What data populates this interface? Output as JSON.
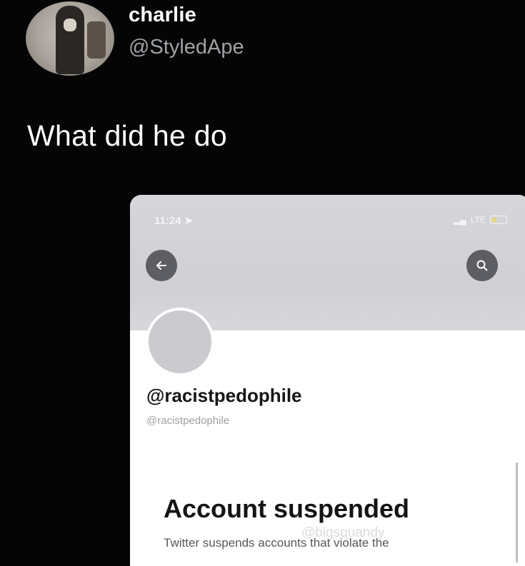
{
  "tweet": {
    "display_name": "charlie",
    "handle": "@StyledApe",
    "text": "What did he do"
  },
  "embedded_screenshot": {
    "status_bar": {
      "time": "11:24",
      "network": "LTE"
    },
    "profile": {
      "display_name": "@racistpedophile",
      "handle": "@racistpedophile"
    },
    "suspension": {
      "title": "Account suspended",
      "body": "Twitter suspends accounts that violate the"
    },
    "watermark": "@bigsquandy"
  },
  "icons": {
    "back": "arrow-left-icon",
    "search": "search-icon",
    "signal": "signal-icon",
    "battery": "battery-icon",
    "location": "location-arrow-icon"
  },
  "colors": {
    "background": "#050505",
    "handle": "#9ea2a6",
    "banner": "#d6d6da",
    "button": "#5d5e63"
  }
}
